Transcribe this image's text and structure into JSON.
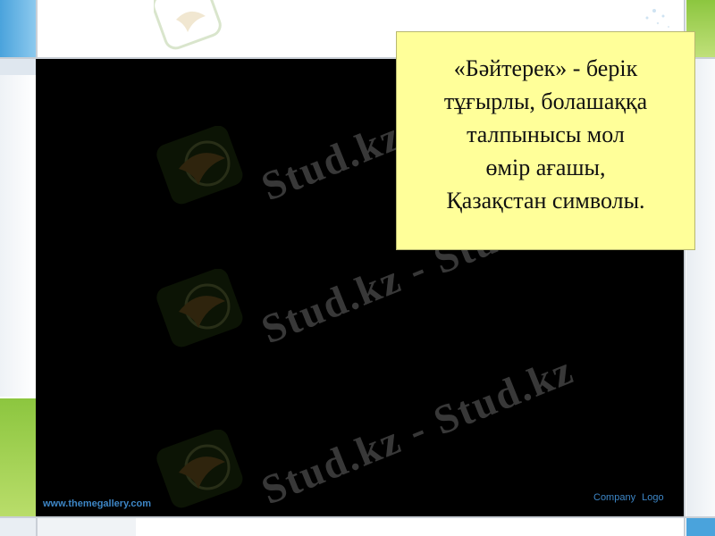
{
  "slide": {
    "callout_lines": [
      "«Бәйтерек» - берік",
      "тұғырлы, болашаққа",
      "талпынысы мол",
      "өмір ағашы,",
      "Қазақстан символы."
    ],
    "website": "www.themegallery.com",
    "company_logo": "Company  Logo"
  },
  "watermark": {
    "text": "Stud.kz - Stud.kz",
    "logo_icon": "hummingbird-logo-icon"
  },
  "colors": {
    "panel": "#000000",
    "callout_bg": "#ffff99",
    "footer_text": "#3d86c6",
    "left_accent_blue": "#4aa3dc",
    "left_accent_green": "#8cc63f"
  }
}
